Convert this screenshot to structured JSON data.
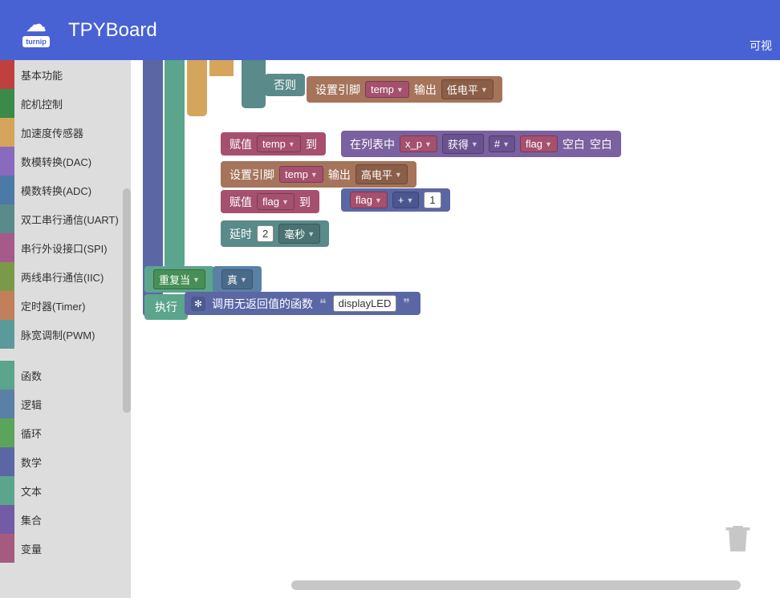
{
  "header": {
    "logo_text": "turnip",
    "title": "TPYBoard",
    "right_label": "可视"
  },
  "sidebar": {
    "items": [
      {
        "label": "基本功能",
        "color": "#c04040"
      },
      {
        "label": "舵机控制",
        "color": "#3a8a4a"
      },
      {
        "label": "加速度传感器",
        "color": "#d4a55a"
      },
      {
        "label": "数模转换(DAC)",
        "color": "#8a6abf"
      },
      {
        "label": "模数转换(ADC)",
        "color": "#4a7aa5"
      },
      {
        "label": "双工串行通信(UART)",
        "color": "#5a8a8a"
      },
      {
        "label": "串行外设接口(SPI)",
        "color": "#a55a8a"
      },
      {
        "label": "两线串行通信(IIC)",
        "color": "#7a9a4a"
      },
      {
        "label": "定时器(Timer)",
        "color": "#c0805a"
      },
      {
        "label": "脉宽调制(PWM)",
        "color": "#5a9a9a"
      }
    ],
    "items2": [
      {
        "label": "函数",
        "color": "#5ba58c"
      },
      {
        "label": "逻辑",
        "color": "#5b80a5"
      },
      {
        "label": "循环",
        "color": "#5ba55b"
      },
      {
        "label": "数学",
        "color": "#5b67a5"
      },
      {
        "label": "文本",
        "color": "#5ba58c"
      },
      {
        "label": "集合",
        "color": "#745ba5"
      },
      {
        "label": "变量",
        "color": "#a55b80"
      }
    ]
  },
  "blocks": {
    "else_label": "否则",
    "set_pin": "设置引脚",
    "temp_var": "temp",
    "output": "输出",
    "low_level": "低电平",
    "high_level": "高电平",
    "assign": "赋值",
    "to": "到",
    "in_list": "在列表中",
    "x_p_var": "x_p",
    "get": "获得",
    "hash": "#",
    "flag_var": "flag",
    "blank": "空白",
    "plus": "+",
    "one": "1",
    "delay": "延时",
    "two": "2",
    "millisec": "毫秒",
    "repeat_while": "重复当",
    "true_val": "真",
    "execute": "执行",
    "call_func": "调用无返回值的函数",
    "display_led": "displayLED"
  }
}
